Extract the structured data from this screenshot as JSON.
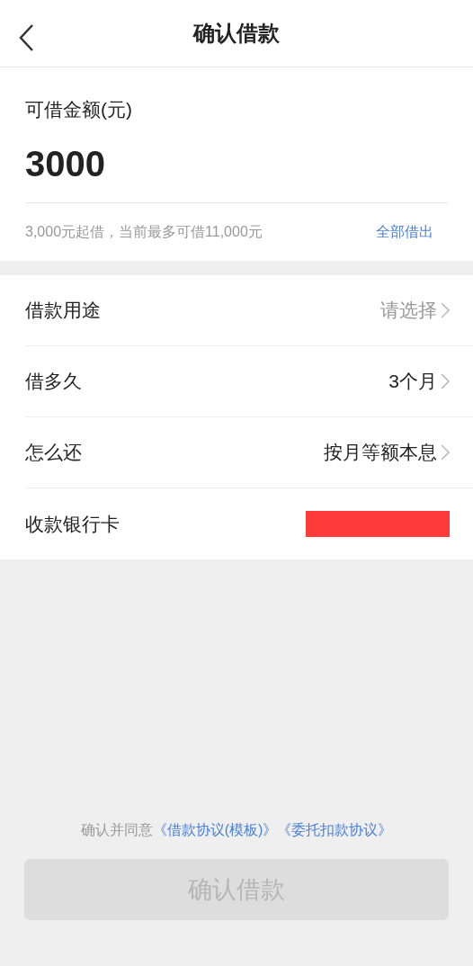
{
  "header": {
    "title": "确认借款"
  },
  "amount": {
    "label": "可借金额(元)",
    "value": "3000",
    "hint": "3,000元起借，当前最多可借11,000元",
    "borrow_all": "全部借出"
  },
  "rows": [
    {
      "kind": "select",
      "label": "借款用途",
      "placeholder": "请选择"
    },
    {
      "kind": "select",
      "label": "借多久",
      "value": "3个月"
    },
    {
      "kind": "select",
      "label": "怎么还",
      "value": "按月等额本息"
    },
    {
      "kind": "redacted",
      "label": "收款银行卡"
    }
  ],
  "agreement": {
    "prefix": "确认并同意",
    "links": [
      "《借款协议(模板)》",
      "《委托扣款协议》"
    ]
  },
  "confirm_button": {
    "label": "确认借款",
    "disabled": true
  }
}
